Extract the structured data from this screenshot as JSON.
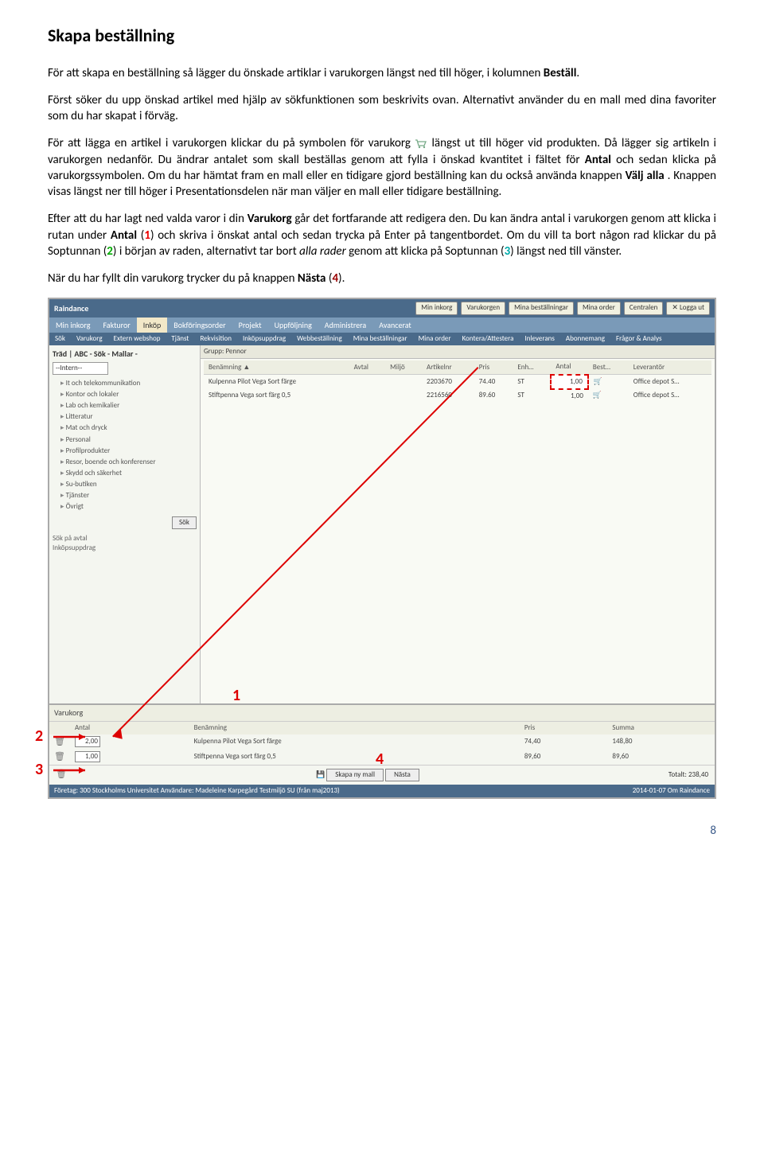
{
  "heading": "Skapa beställning",
  "para1a": "För att skapa en beställning så lägger du önskade artiklar i varukorgen längst ned till höger, i kolumnen ",
  "para1b": "Beställ",
  "para1c": ".",
  "para2": "Först söker du upp önskad artikel med hjälp av sökfunktionen som beskrivits ovan. Alternativt använder du en mall med dina favoriter som du har skapat i förväg.",
  "para3a": "För att lägga en artikel i varukorgen klickar du på symbolen för varukorg ",
  "para3b": " längst ut till höger vid produkten. Då lägger sig artikeln i varukorgen nedanför. Du ändrar antalet som skall beställas genom att fylla i önskad kvantitet i fältet för ",
  "para3c": "Antal",
  "para3d": " och sedan klicka på varukorgssymbolen. Om du har hämtat fram en mall eller en tidigare gjord beställning kan du också använda knappen ",
  "para3e": "Välj alla",
  "para3f": ". Knappen visas längst ner till höger i Presentationsdelen när man väljer en mall eller tidigare beställning.",
  "para4a": "Efter att du har lagt ned valda varor i din ",
  "para4b": "Varukorg",
  "para4c": " går det fortfarande att redigera den. Du kan ändra antal i varukorgen genom att klicka i rutan under ",
  "para4d": "Antal",
  "para4e": " (",
  "para4f": "1",
  "para4g": ") och skriva i önskat antal och sedan trycka på Enter på tangentbordet. Om du vill ta bort någon rad klickar du på Soptunnan (",
  "para4h": "2",
  "para4i": ") i början av raden, alternativt tar bort ",
  "para4j": "alla rader",
  "para4k": " genom att klicka på Soptunnan (",
  "para4l": "3",
  "para4m": ") längst ned till vänster.",
  "para5a": "När du har fyllt din varukorg trycker du på knappen ",
  "para5b": "Nästa",
  "para5c": " (",
  "para5d": "4",
  "para5e": ").",
  "page_number": "8",
  "app": {
    "brand": "Raindance",
    "top_buttons": [
      "Min inkorg",
      "Varukorgen",
      "Mina beställningar",
      "Mina order",
      "Centralen",
      "Logga ut"
    ],
    "menu": [
      "Min inkorg",
      "Fakturor",
      "Inköp",
      "Bokföringsorder",
      "Projekt",
      "Uppföljning",
      "Administrera",
      "Avancerat"
    ],
    "menu_active_index": 2,
    "submenu": [
      "Sök",
      "Varukorg",
      "Extern webshop",
      "Tjänst",
      "Rekvisition",
      "Inköpsuppdrag",
      "Webbeställning",
      "Mina beställningar",
      "Mina order",
      "Kontera/Attestera",
      "Inleverans",
      "Abonnemang",
      "Frågor & Analys"
    ],
    "sidebar": {
      "tabs": "Träd | ABC - Sök - Mallar -",
      "tree_title": "--Intern--",
      "items": [
        "It och telekommunikation",
        "Kontor och lokaler",
        "Lab och kemikalier",
        "Litteratur",
        "Mat och dryck",
        "Personal",
        "Profilprodukter",
        "Resor, boende och konferenser",
        "Skydd och säkerhet",
        "Su-butiken",
        "Tjänster",
        "Övrigt"
      ],
      "sok_btn": "Sök",
      "bottom1": "Sök på avtal",
      "bottom2": "Inköpsuppdrag"
    },
    "grid": {
      "group": "Grupp: Pennor",
      "headers": [
        "Benämning ▲",
        "Avtal",
        "Miljö",
        "Artikelnr",
        "Pris",
        "Enh…",
        "Antal",
        "Best…",
        "Leverantör"
      ],
      "rows": [
        {
          "name": "Kulpenna Pilot Vega Sort färge",
          "art": "2203670",
          "pris": "74.40",
          "enh": "ST",
          "antal": "1,00",
          "lev": "Office depot S…"
        },
        {
          "name": "Stiftpenna Vega sort färg 0,5",
          "art": "2216560",
          "pris": "89.60",
          "enh": "ST",
          "antal": "1,00",
          "lev": "Office depot S…"
        }
      ]
    },
    "cart": {
      "title": "Varukorg",
      "headers": [
        "",
        "Antal",
        "Benämning",
        "Pris",
        "Summa"
      ],
      "rows": [
        {
          "antal": "2,00",
          "name": "Kulpenna Pilot Vega Sort färge",
          "pris": "74,40",
          "sum": "148,80"
        },
        {
          "antal": "1,00",
          "name": "Stiftpenna Vega sort färg 0,5",
          "pris": "89,60",
          "sum": "89,60"
        }
      ],
      "skapa_btn": "Skapa ny mall",
      "nasta_btn": "Nästa",
      "total_lbl": "Totalt: 238,40"
    },
    "status_left": "Företag: 300 Stockholms Universitet    Användare: Madeleine Karpegård    Testmiljö SU (från maj2013)",
    "status_right": "2014-01-07  Om Raindance"
  },
  "annotations": {
    "n1": "1",
    "n2": "2",
    "n3": "3",
    "n4": "4"
  }
}
